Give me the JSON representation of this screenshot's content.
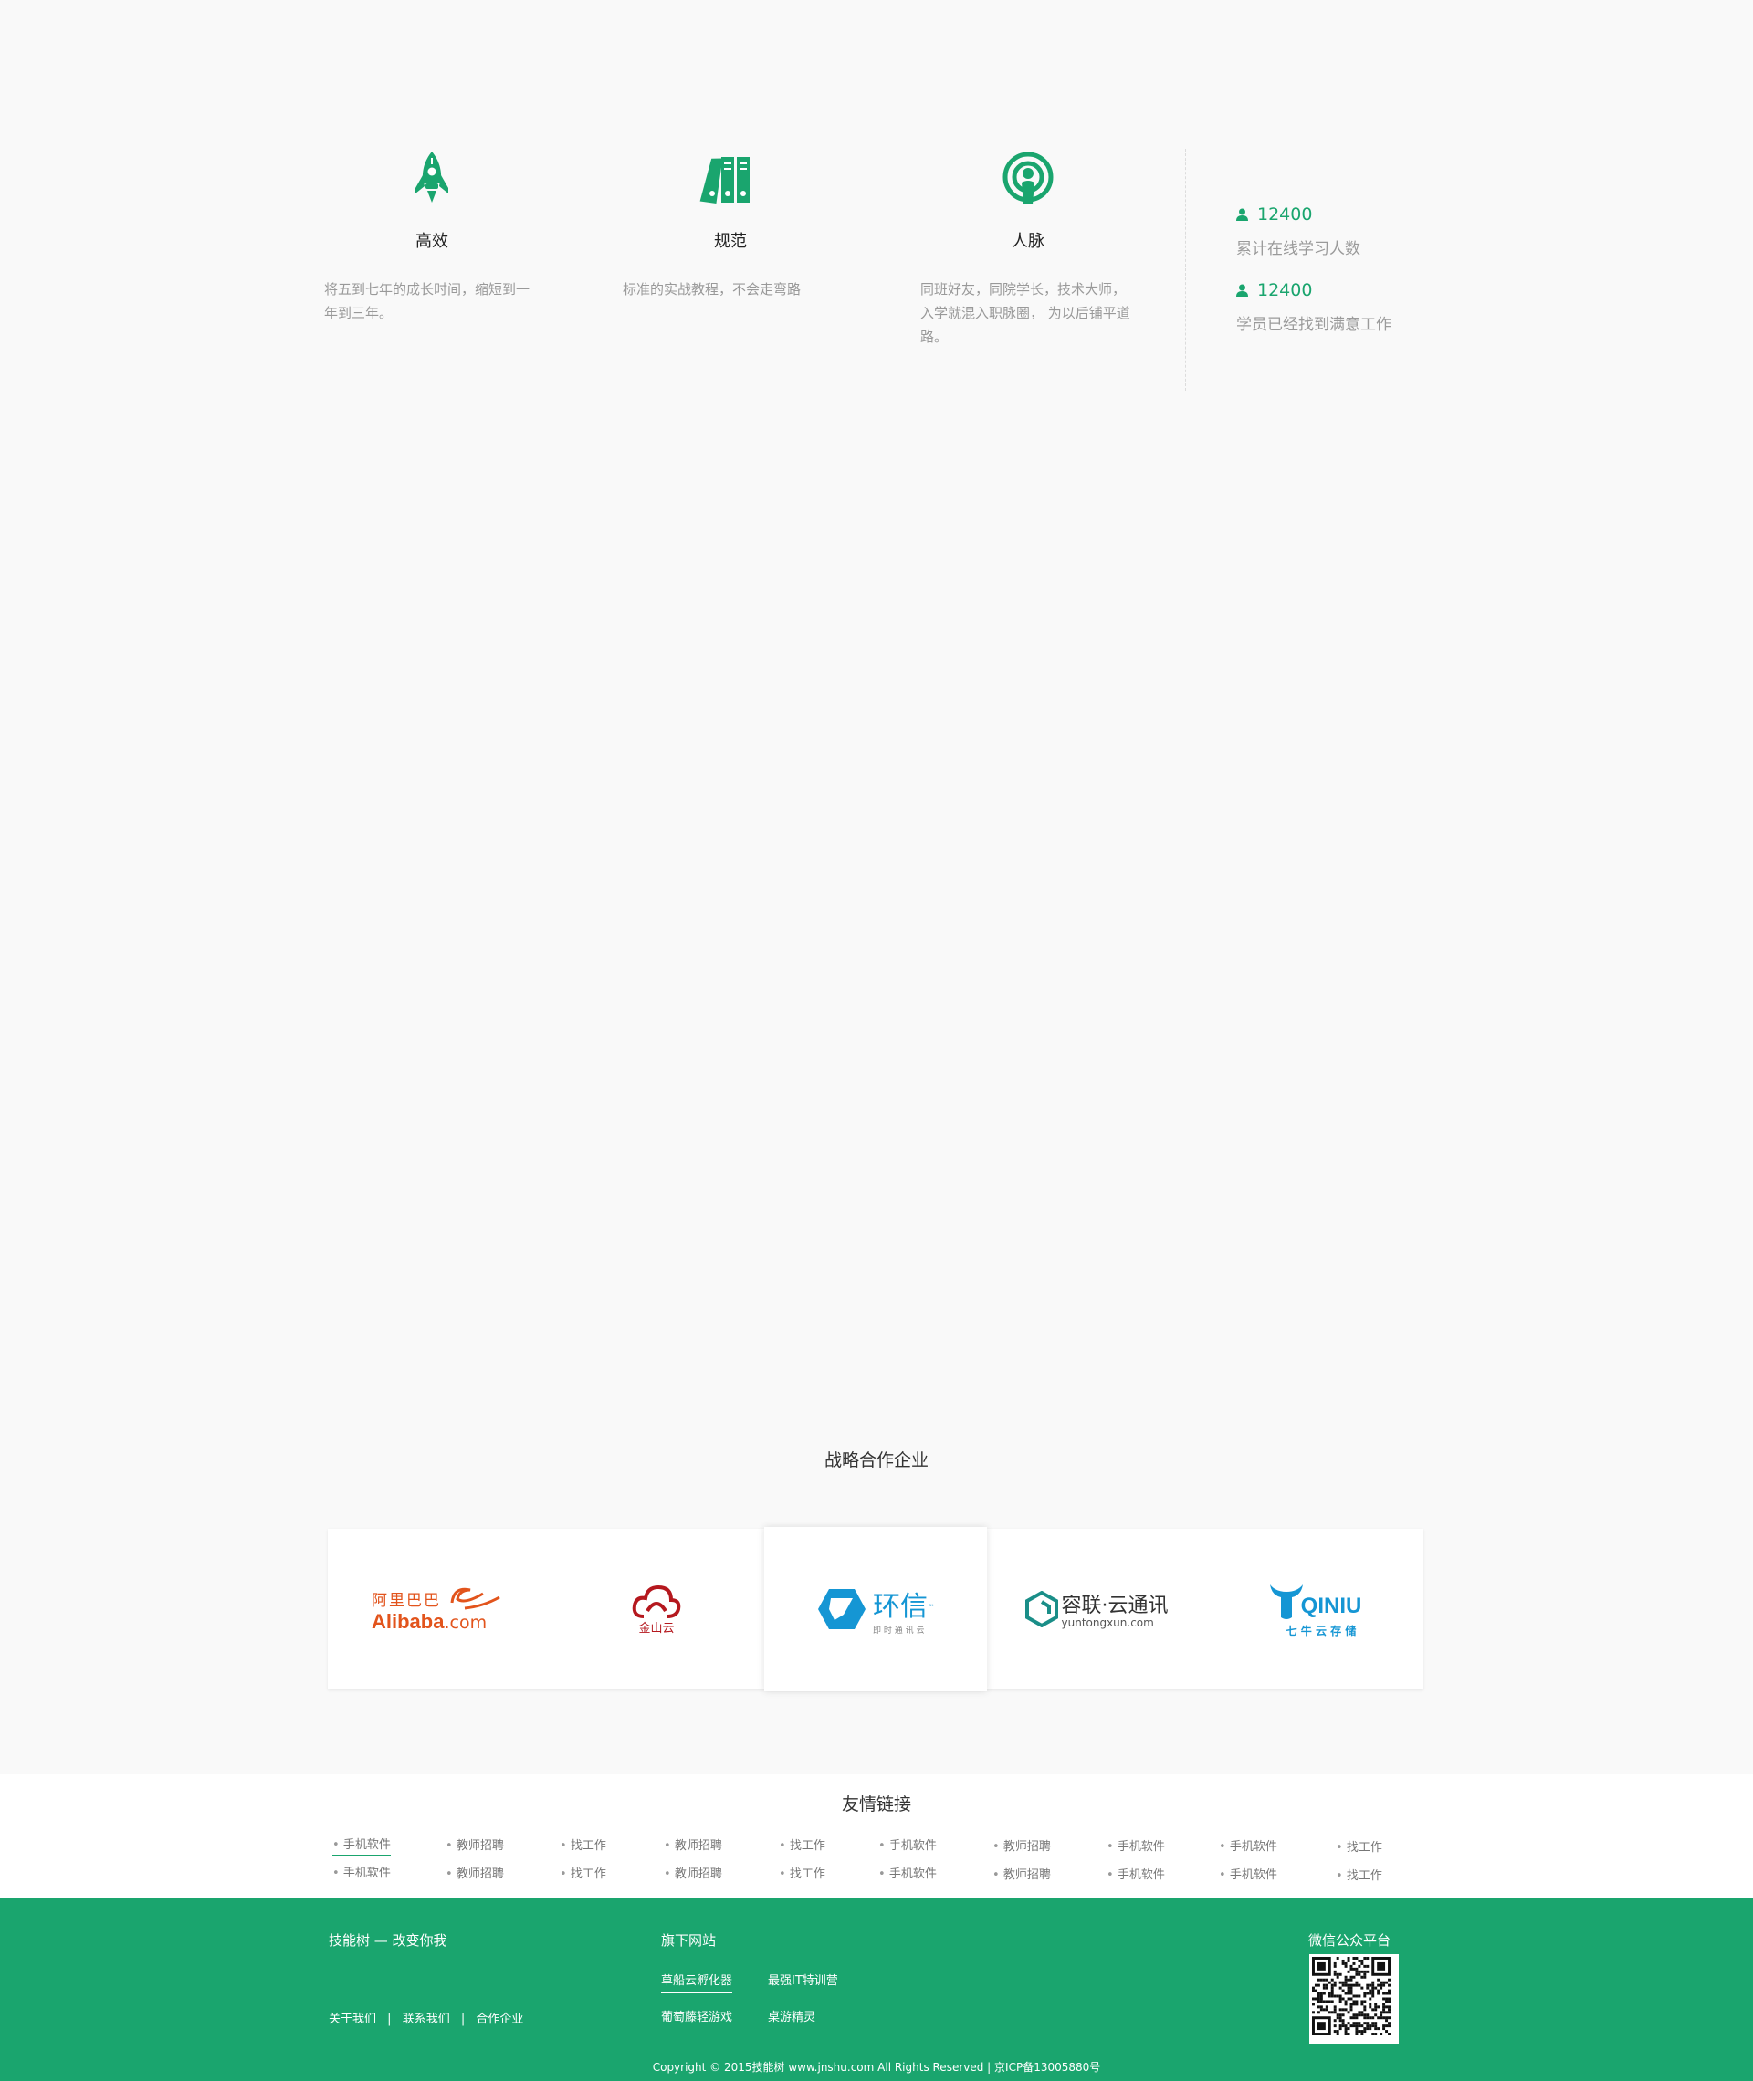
{
  "features": [
    {
      "icon": "rocket-icon",
      "title": "高效",
      "desc": "将五到七年的成长时间，缩短到一年到三年。"
    },
    {
      "icon": "binders-icon",
      "title": "规范",
      "desc": "标准的实战教程，不会走弯路"
    },
    {
      "icon": "network-icon",
      "title": "人脉",
      "desc": "同班好友，同院学长，技术大师，入学就混入职脉圈， 为以后铺平道路。"
    }
  ],
  "stats": [
    {
      "icon": "user-icon",
      "value": "12400",
      "label": "累计在线学习人数"
    },
    {
      "icon": "user-icon",
      "value": "12400",
      "label": "学员已经找到满意工作"
    }
  ],
  "partners": {
    "title": "战略合作企业",
    "logos": [
      {
        "name": "alibaba",
        "cn": "阿里巴巴",
        "en": "Alibaba",
        "suffix": ".com"
      },
      {
        "name": "kingsoft",
        "cn": "金山云"
      },
      {
        "name": "huanxin",
        "cn": "环信",
        "sub": "即 时 通 讯 云",
        "tm": "™"
      },
      {
        "name": "ronglian",
        "cn": "容联·云通讯",
        "en": "yuntongxun.com"
      },
      {
        "name": "qiniu",
        "en": "QINIU",
        "cn": "七 牛 云 存 储"
      }
    ]
  },
  "friend_links": {
    "title": "友情链接",
    "row1": [
      "手机软件",
      "教师招聘",
      "找工作",
      "教师招聘",
      "找工作",
      "手机软件",
      "教师招聘",
      "手机软件",
      "手机软件",
      "找工作"
    ],
    "row2": [
      "手机软件",
      "教师招聘",
      "找工作",
      "教师招聘",
      "找工作",
      "手机软件",
      "教师招聘",
      "手机软件",
      "手机软件",
      "找工作"
    ]
  },
  "footer": {
    "slogan": "技能树 — 改变你我",
    "about": "关于我们",
    "contact": "联系我们",
    "partners": "合作企业",
    "sep": "|",
    "sites_title": "旗下网站",
    "sites": [
      "草船云孵化器",
      "最强IT特训营",
      "葡萄藤轻游戏",
      "桌游精灵"
    ],
    "wechat_title": "微信公众平台",
    "copyright": "Copyright © 2015技能树 www.jnshu.com  All Rights Reserved | 京ICP备13005880号"
  },
  "colors": {
    "brand": "#1aa56e",
    "text": "#333333",
    "muted": "#999999"
  }
}
